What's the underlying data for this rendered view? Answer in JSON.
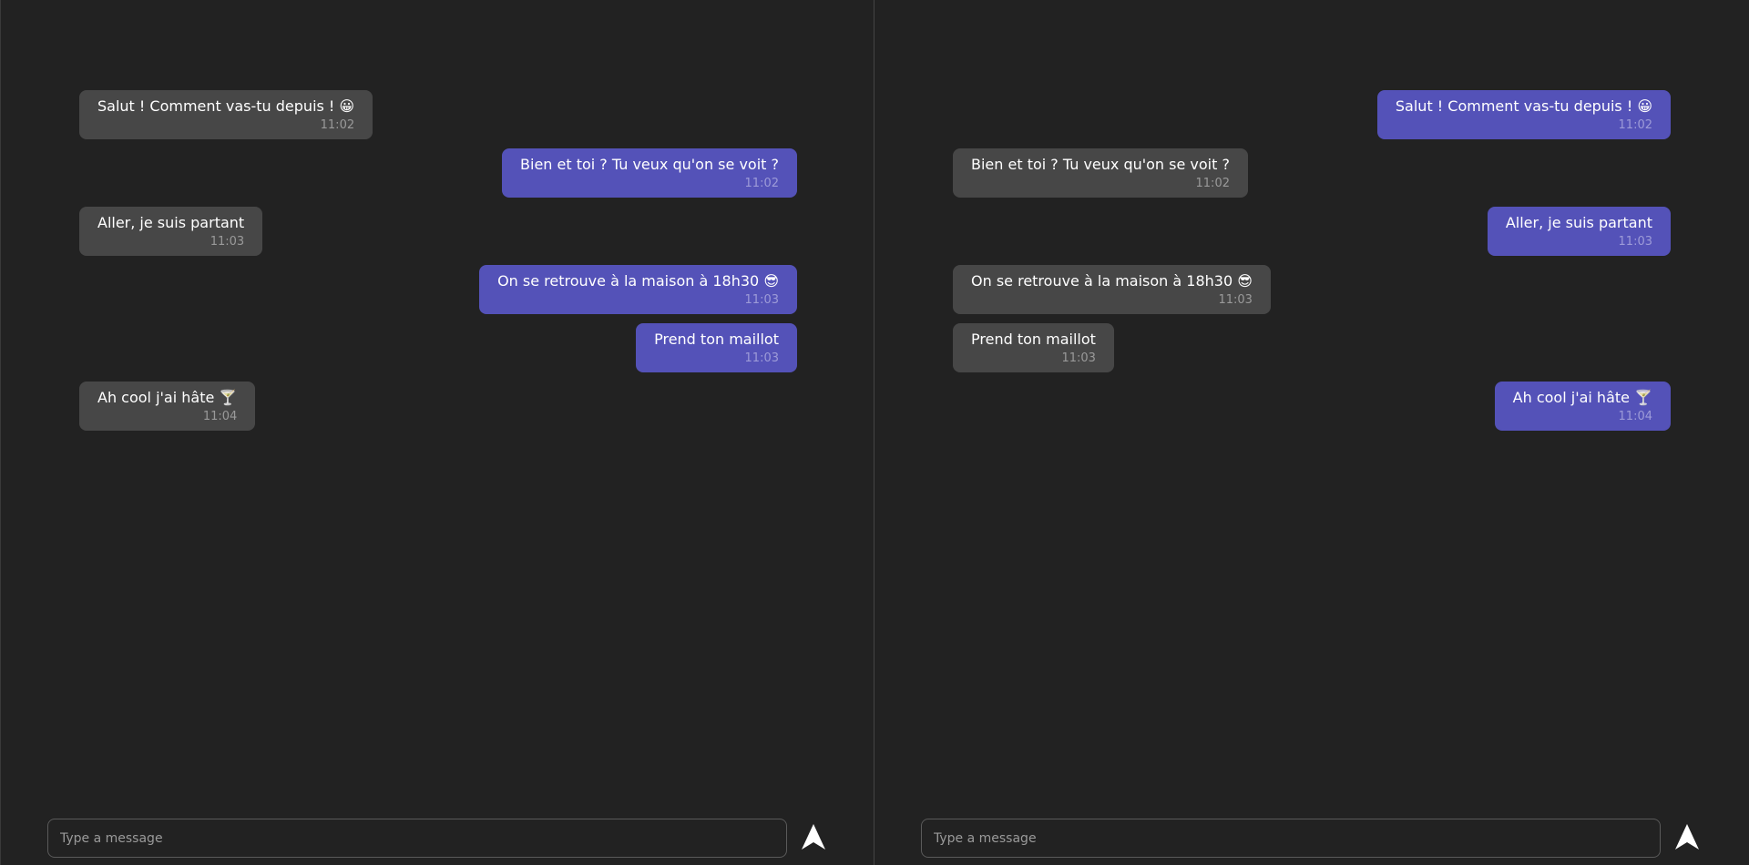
{
  "colors": {
    "background": "#222222",
    "incoming_bubble": "#474747",
    "outgoing_bubble": "#5452b8",
    "text": "#ffffff",
    "timestamp": "#9a9a9a"
  },
  "panes": [
    {
      "messages": [
        {
          "direction": "in",
          "text": "Salut ! Comment vas-tu depuis ! 😀",
          "time": "11:02"
        },
        {
          "direction": "out",
          "text": "Bien et toi ? Tu veux qu'on se voit ?",
          "time": "11:02"
        },
        {
          "direction": "in",
          "text": "Aller, je suis partant",
          "time": "11:03"
        },
        {
          "direction": "out",
          "text": "On se retrouve à la maison à 18h30 😎",
          "time": "11:03"
        },
        {
          "direction": "out",
          "text": "Prend ton maillot",
          "time": "11:03"
        },
        {
          "direction": "in",
          "text": "Ah cool j'ai hâte 🍸",
          "time": "11:04"
        }
      ],
      "composer": {
        "placeholder": "Type a message",
        "value": "",
        "send_icon": "send-arrow-icon"
      }
    },
    {
      "messages": [
        {
          "direction": "out",
          "text": "Salut ! Comment vas-tu depuis ! 😀",
          "time": "11:02"
        },
        {
          "direction": "in",
          "text": "Bien et toi ? Tu veux qu'on se voit ?",
          "time": "11:02"
        },
        {
          "direction": "out",
          "text": "Aller, je suis partant",
          "time": "11:03"
        },
        {
          "direction": "in",
          "text": "On se retrouve à la maison à 18h30 😎",
          "time": "11:03"
        },
        {
          "direction": "in",
          "text": "Prend ton maillot",
          "time": "11:03"
        },
        {
          "direction": "out",
          "text": "Ah cool j'ai hâte 🍸",
          "time": "11:04"
        }
      ],
      "composer": {
        "placeholder": "Type a message",
        "value": "",
        "send_icon": "send-arrow-icon"
      }
    }
  ]
}
